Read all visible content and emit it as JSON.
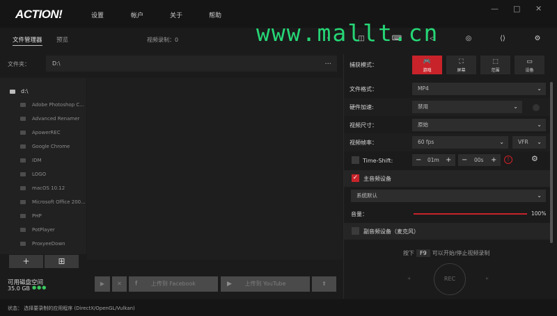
{
  "app": {
    "logo": "ACTION!",
    "menu": [
      "设置",
      "帐户",
      "关于",
      "帮助"
    ],
    "window_controls": [
      "—",
      "□",
      "✕"
    ]
  },
  "watermark": "www.mallt.cn",
  "tabs": {
    "file_manager": "文件管理器",
    "preview": "预览",
    "recording_count": "视频录制：0"
  },
  "folder": {
    "label": "文件夹：",
    "path": "D:\\",
    "more": "..."
  },
  "tree": {
    "root": "d:\\",
    "items": [
      "Adobe Photoshop C...",
      "Advanced Renamer",
      "ApowerREC",
      "Google Chrome",
      "IDM",
      "LOGO",
      "macOS 10.12",
      "Microsoft Office 200...",
      "PHP",
      "PotPlayer",
      "ProxyeeDown"
    ],
    "add": "+",
    "add_folder": "⊞"
  },
  "disk": {
    "label": "可用磁盘空间",
    "size": "35.0 GB",
    "dots": "●●●"
  },
  "actions": {
    "play": "▶",
    "delete": "✕",
    "facebook_icon": "f",
    "facebook": "上传到 Facebook",
    "youtube_icon": "▶",
    "youtube": "上传到 YouTube",
    "upload": "⬆"
  },
  "status": "状态：  选择要录制的应用程序 (DirectX/OpenGL/Vulkan)",
  "capture": {
    "label": "捕获模式：",
    "modes": [
      {
        "label": "游戏",
        "glyph": "🎮"
      },
      {
        "label": "屏幕",
        "glyph": "⛶"
      },
      {
        "label": "范围",
        "glyph": "⬚"
      },
      {
        "label": "设备",
        "glyph": "▭"
      }
    ]
  },
  "settings": {
    "format": {
      "label": "文件格式：",
      "value": "MP4"
    },
    "hw": {
      "label": "硬件加速:",
      "value": "禁用"
    },
    "size": {
      "label": "视频尺寸：",
      "value": "原始"
    },
    "fps": {
      "label": "视频帧率：",
      "value": "60 fps",
      "mode": "VFR"
    },
    "timeshift": {
      "label": "Time-Shift:",
      "minus": "−",
      "plus": "+",
      "minutes": "01m",
      "seconds": "00s",
      "warn": "!"
    }
  },
  "audio": {
    "main_label": "主音频设备",
    "main_device": "系统默认",
    "volume_label": "音量：",
    "volume_value": "100%",
    "volume_fraction": 1.0,
    "mic_label": "副音频设备（麦克风）"
  },
  "hotkey": {
    "prefix": "按下",
    "key": "F9",
    "suffix": "可以开始/停止视频录制"
  },
  "rec": "REC"
}
